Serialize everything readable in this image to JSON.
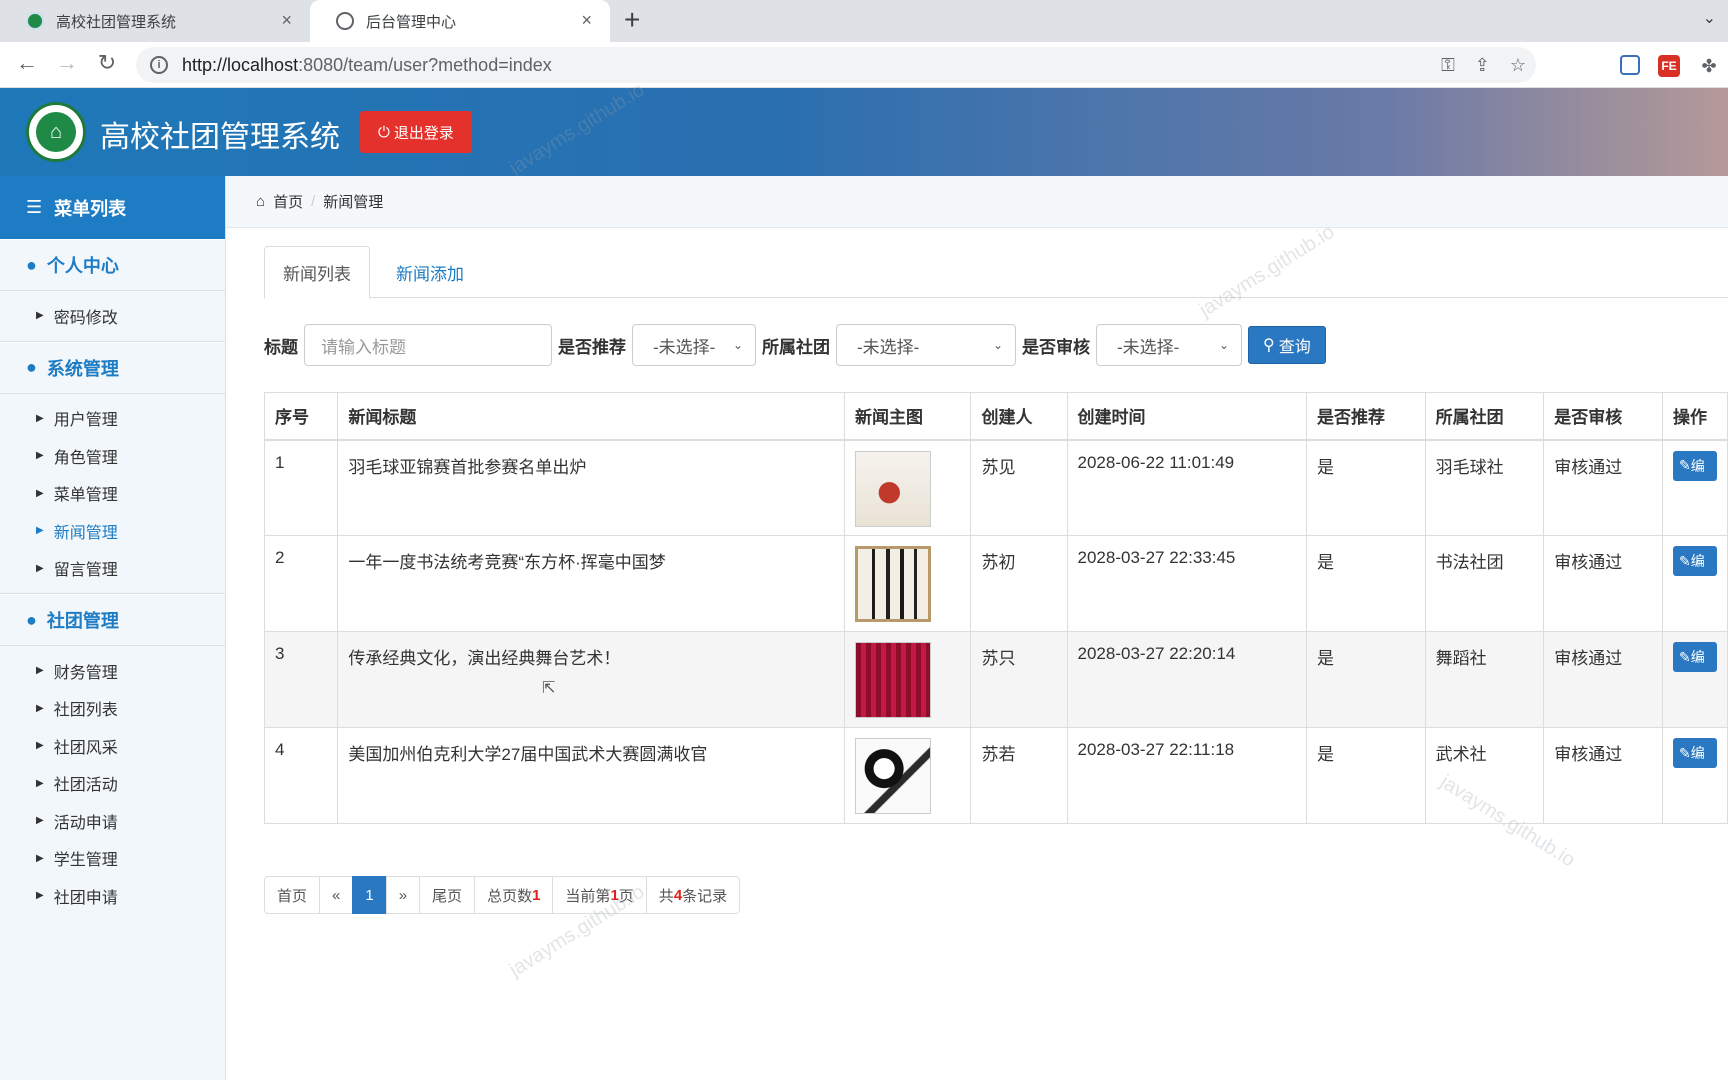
{
  "browser": {
    "tabs": [
      {
        "title": "高校社团管理系统",
        "close": "×"
      },
      {
        "title": "后台管理中心",
        "close": "×"
      }
    ],
    "new_tab": "+",
    "tab_menu": "⌄",
    "url_host": "http://localhost",
    "url_rest": ":8080/team/user?method=index",
    "ext_fe_label": "FE"
  },
  "header": {
    "app_title": "高校社团管理系统",
    "logout_label": "退出登录",
    "logo_glyph": "⌂"
  },
  "sidebar": {
    "menu_title": "菜单列表",
    "groups": [
      {
        "label": "个人中心",
        "items": [
          "密码修改"
        ]
      },
      {
        "label": "系统管理",
        "items": [
          "用户管理",
          "角色管理",
          "菜单管理",
          "新闻管理",
          "留言管理"
        ]
      },
      {
        "label": "社团管理",
        "items": [
          "财务管理",
          "社团列表",
          "社团风采",
          "社团活动",
          "活动申请",
          "学生管理",
          "社团申请"
        ]
      }
    ],
    "active_item": "新闻管理"
  },
  "breadcrumb": {
    "home": "首页",
    "current": "新闻管理"
  },
  "page_tabs": {
    "list": "新闻列表",
    "add": "新闻添加"
  },
  "filter": {
    "title_label": "标题",
    "title_placeholder": "请输入标题",
    "recommend_label": "是否推荐",
    "recommend_value": "-未选择-",
    "club_label": "所属社团",
    "club_value": "-未选择-",
    "audit_label": "是否审核",
    "audit_value": "-未选择-",
    "query_label": "查询"
  },
  "table": {
    "headers": [
      "序号",
      "新闻标题",
      "新闻主图",
      "创建人",
      "创建时间",
      "是否推荐",
      "所属社团",
      "是否审核",
      "操作"
    ],
    "rows": [
      {
        "no": "1",
        "title": "羽毛球亚锦赛首批参赛名单出炉",
        "creator": "苏见",
        "time": "2028-06-22 11:01:49",
        "recommend": "是",
        "club": "羽毛球社",
        "audit": "审核通过",
        "action": "编"
      },
      {
        "no": "2",
        "title": "一年一度书法统考竞赛“东方杯·挥毫中国梦",
        "creator": "苏初",
        "time": "2028-03-27 22:33:45",
        "recommend": "是",
        "club": "书法社团",
        "audit": "审核通过",
        "action": "编"
      },
      {
        "no": "3",
        "title": "传承经典文化，演出经典舞台艺术！",
        "creator": "苏只",
        "time": "2028-03-27 22:20:14",
        "recommend": "是",
        "club": "舞蹈社",
        "audit": "审核通过",
        "action": "编"
      },
      {
        "no": "4",
        "title": "美国加州伯克利大学27届中国武术大赛圆满收官",
        "creator": "苏若",
        "time": "2028-03-27 22:11:18",
        "recommend": "是",
        "club": "武术社",
        "audit": "审核通过",
        "action": "编"
      }
    ]
  },
  "pager": {
    "first": "首页",
    "prev": "«",
    "current": "1",
    "next": "»",
    "last": "尾页",
    "total_pages_label": "总页数",
    "total_pages": "1",
    "current_page_prefix": "当前第",
    "current_page": "1",
    "current_page_suffix": "页",
    "total_records_prefix": "共",
    "total_records": "4",
    "total_records_suffix": "条记录"
  },
  "watermark": "javayms.github.io",
  "colors": {
    "primary": "#1e7cc4",
    "danger": "#e5312c",
    "success": "#1f9a30"
  }
}
